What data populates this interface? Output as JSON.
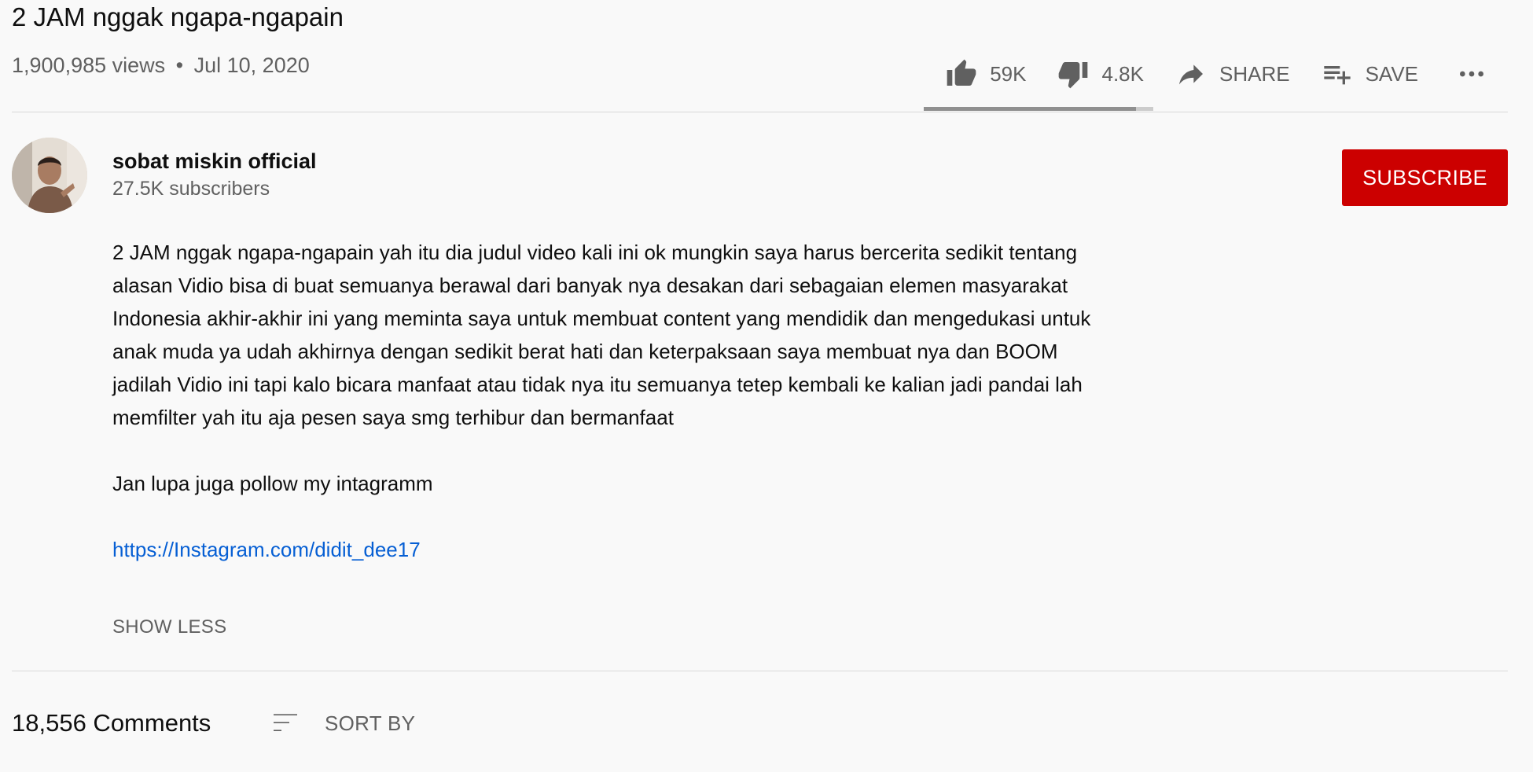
{
  "video": {
    "title": "2 JAM nggak ngapa-ngapain",
    "views": "1,900,985 views",
    "separator": "•",
    "date": "Jul 10, 2020"
  },
  "actions": {
    "like_count": "59K",
    "dislike_count": "4.8K",
    "share_label": "SHARE",
    "save_label": "SAVE",
    "like_ratio": 0.925
  },
  "channel": {
    "name": "sobat miskin official",
    "subscribers": "27.5K subscribers",
    "subscribe_label": "SUBSCRIBE"
  },
  "description": {
    "paragraph1": "2 JAM nggak ngapa-ngapain yah itu dia judul video kali ini ok mungkin saya harus bercerita sedikit tentang alasan Vidio bisa di buat semuanya berawal dari banyak nya desakan dari sebagaian elemen masyarakat Indonesia akhir-akhir ini yang meminta saya untuk membuat content yang mendidik dan mengedukasi untuk anak muda ya udah akhirnya dengan sedikit berat hati dan keterpaksaan saya membuat nya dan BOOM jadilah Vidio ini tapi kalo bicara manfaat atau tidak nya itu semuanya tetep kembali ke kalian jadi pandai lah memfilter yah itu aja pesen saya smg terhibur dan bermanfaat",
    "paragraph2": "Jan lupa juga pollow my intagramm",
    "link": "https://Instagram.com/didit_dee17",
    "show_less_label": "SHOW LESS"
  },
  "comments": {
    "count_label": "18,556 Comments",
    "sort_label": "SORT BY"
  },
  "colors": {
    "subscribe_bg": "#cc0000",
    "link": "#065fd4",
    "secondary_text": "#606060"
  },
  "icons": [
    "thumb-up-icon",
    "thumb-down-icon",
    "share-icon",
    "playlist-add-icon",
    "more-horiz-icon",
    "sort-icon"
  ]
}
